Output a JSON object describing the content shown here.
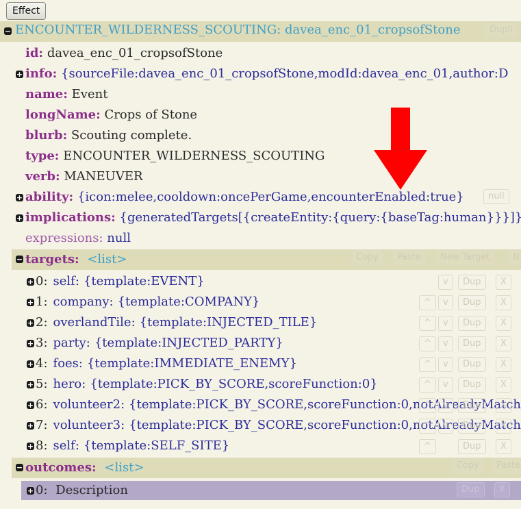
{
  "toolbar": {
    "effect_label": "Effect"
  },
  "header": {
    "title": "ENCOUNTER_WILDERNESS_SCOUTING: davea_enc_01_cropsofStone",
    "dupli_button": "Dupli"
  },
  "fields": {
    "id": {
      "key": "id:",
      "value": "davea_enc_01_cropsofStone"
    },
    "info": {
      "key": "info:",
      "value": "{sourceFile:davea_enc_01_cropsofStone,modId:davea_enc_01,author:D"
    },
    "name": {
      "key": "name:",
      "value": "Event"
    },
    "longName": {
      "key": "longName:",
      "value": "Crops of Stone"
    },
    "blurb": {
      "key": "blurb:",
      "value": "Scouting complete."
    },
    "type": {
      "key": "type:",
      "value": "ENCOUNTER_WILDERNESS_SCOUTING"
    },
    "verb": {
      "key": "verb:",
      "value": "MANEUVER"
    },
    "ability": {
      "key": "ability:",
      "value": "{icon:melee,cooldown:oncePerGame,encounterEnabled:true}",
      "null_button": "null"
    },
    "implications": {
      "key": "implications:",
      "value": "{generatedTargets[{createEntity:{query:{baseTag:human}}}]}"
    },
    "expressions": {
      "key": "expressions:",
      "value": "null"
    }
  },
  "targets": {
    "key": "targets:",
    "tag": "<list>",
    "buttons": {
      "copy": "Copy",
      "paste": "Paste",
      "new_target": "New Target",
      "n": "N"
    },
    "row_buttons": {
      "up": "^",
      "down": "v",
      "dup": "Dup",
      "remove": "X"
    },
    "items": [
      {
        "index": "0:",
        "key": "self:",
        "value": "{template:EVENT}"
      },
      {
        "index": "1:",
        "key": "company:",
        "value": "{template:COMPANY}"
      },
      {
        "index": "2:",
        "key": "overlandTile:",
        "value": "{template:INJECTED_TILE}"
      },
      {
        "index": "3:",
        "key": "party:",
        "value": "{template:INJECTED_PARTY}"
      },
      {
        "index": "4:",
        "key": "foes:",
        "value": "{template:IMMEDIATE_ENEMY}"
      },
      {
        "index": "5:",
        "key": "hero:",
        "value": "{template:PICK_BY_SCORE,scoreFunction:0}"
      },
      {
        "index": "6:",
        "key": "volunteer2:",
        "value": "{template:PICK_BY_SCORE,scoreFunction:0,notAlreadyMatch"
      },
      {
        "index": "7:",
        "key": "volunteer3:",
        "value": "{template:PICK_BY_SCORE,scoreFunction:0,notAlreadyMatch"
      },
      {
        "index": "8:",
        "key": "self:",
        "value": "{template:SELF_SITE}"
      }
    ]
  },
  "outcomes": {
    "key": "outcomes:",
    "tag": "<list>",
    "buttons": {
      "copy": "Copy",
      "paste": "Paste"
    },
    "items": [
      {
        "index": "0:",
        "value": "Description",
        "dup": "Dup",
        "remove": "X"
      }
    ]
  },
  "colors": {
    "background": "#f5f2e6",
    "header_band": "#dedbb9",
    "section_band": "#dedbb9",
    "selected_row": "#b4a8c9",
    "key_purple": "#8b2f8b",
    "value_blue": "#2b2c9a",
    "title_cyan": "#3fa0c8",
    "annotation_arrow": "#ff0000"
  }
}
